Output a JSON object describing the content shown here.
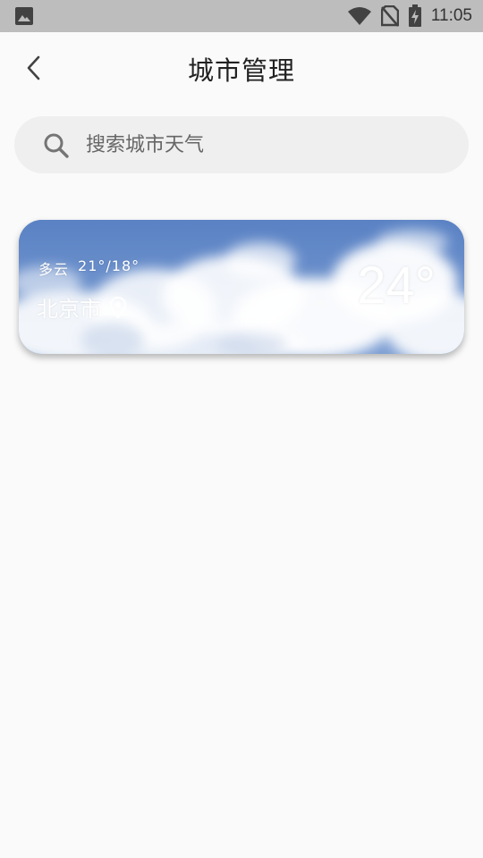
{
  "status_bar": {
    "time": "11:05",
    "icons": [
      "image-icon",
      "wifi-icon",
      "no-sim-icon",
      "battery-charging-icon"
    ]
  },
  "header": {
    "title": "城市管理",
    "back_icon": "chevron-left-icon"
  },
  "search": {
    "placeholder": "搜索城市天气",
    "icon": "search-icon"
  },
  "city_cards": [
    {
      "condition": "多云",
      "temp_range": "21°/18°",
      "city": "北京市",
      "current_temp": "24°",
      "location_icon": "location-pin-icon"
    }
  ],
  "colors": {
    "background": "#fafafa",
    "status_bar": "#bdbdbd",
    "search_bg": "#efefef",
    "sky": "#5d86c6",
    "text_primary": "#212121"
  }
}
